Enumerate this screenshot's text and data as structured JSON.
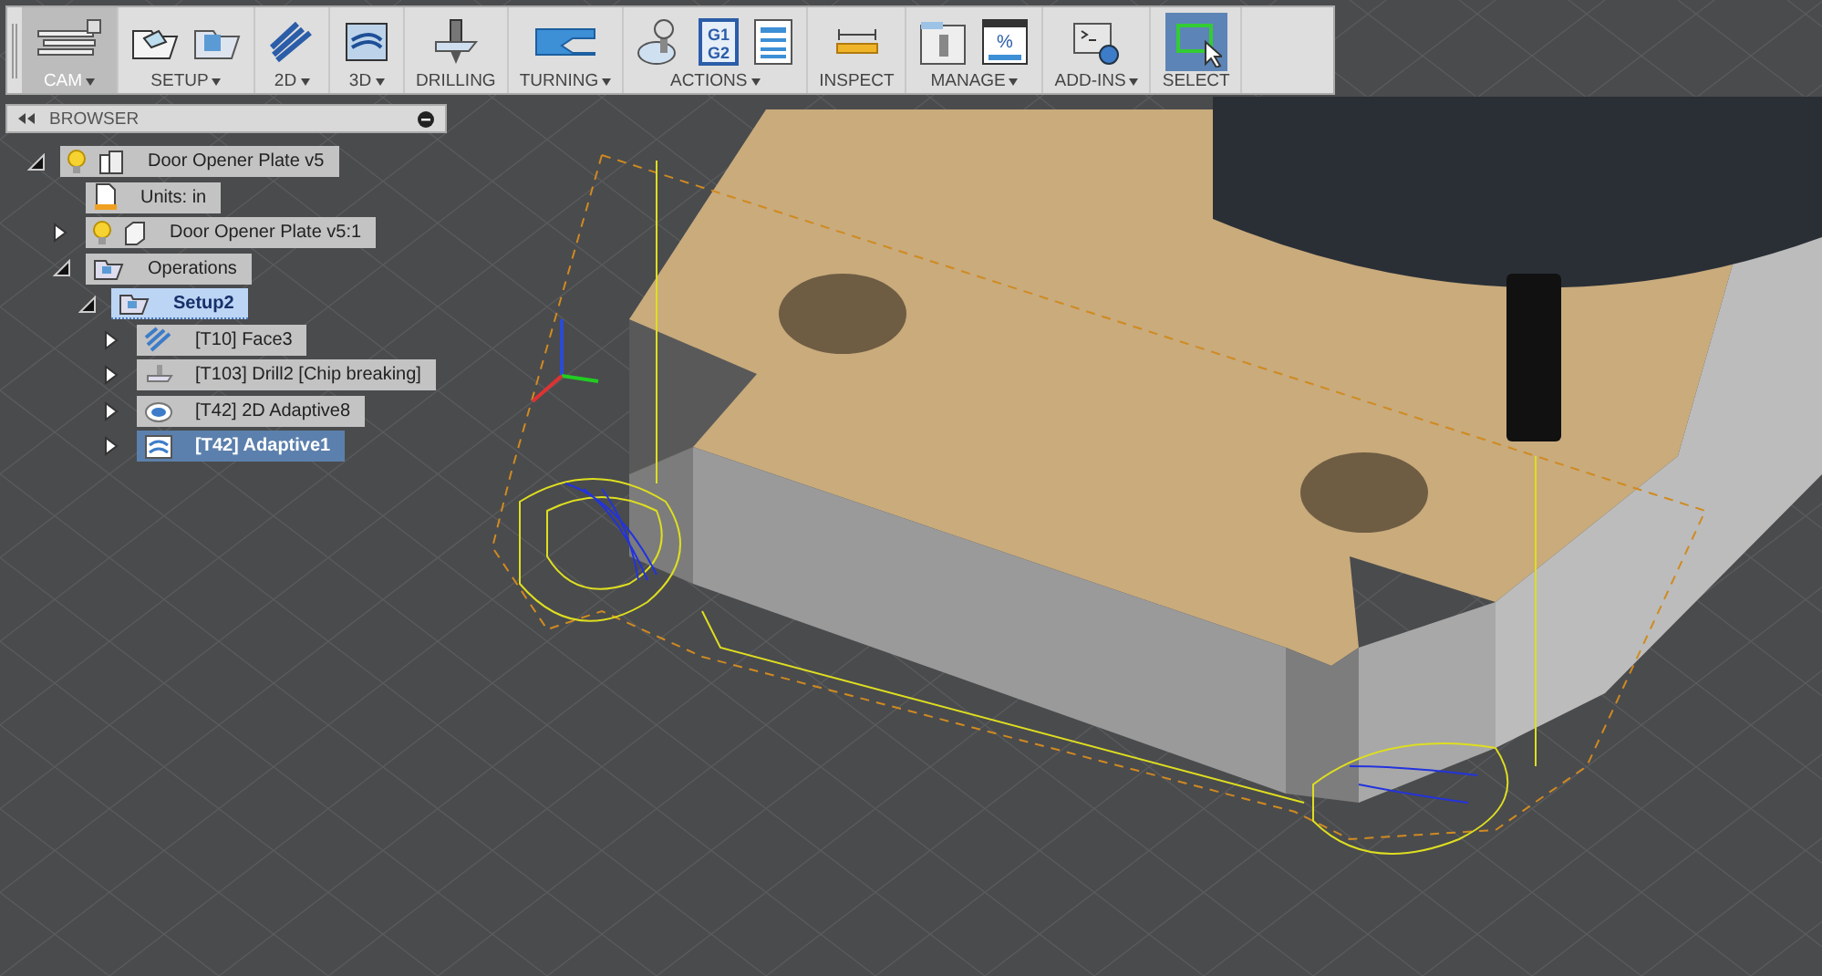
{
  "toolbar": {
    "groups": [
      {
        "label": "CAM",
        "dropdown": true,
        "selected": true
      },
      {
        "label": "SETUP",
        "dropdown": true,
        "selected": false
      },
      {
        "label": "2D",
        "dropdown": true,
        "selected": false
      },
      {
        "label": "3D",
        "dropdown": true,
        "selected": false
      },
      {
        "label": "DRILLING",
        "dropdown": false,
        "selected": false
      },
      {
        "label": "TURNING",
        "dropdown": true,
        "selected": false
      },
      {
        "label": "ACTIONS",
        "dropdown": true,
        "selected": false,
        "icon_text": [
          "G1",
          "G2"
        ]
      },
      {
        "label": "INSPECT",
        "dropdown": false,
        "selected": false
      },
      {
        "label": "MANAGE",
        "dropdown": true,
        "selected": false,
        "icon_text": [
          "%"
        ]
      },
      {
        "label": "ADD-INS",
        "dropdown": true,
        "selected": false
      },
      {
        "label": "SELECT",
        "dropdown": false,
        "selected": true
      }
    ]
  },
  "browser": {
    "title": "BROWSER",
    "tree": [
      {
        "label": "Door Opener Plate v5",
        "kind": "document",
        "expanded": true,
        "visible": true,
        "selected": false,
        "active": false,
        "children": [
          {
            "label": "Units: in",
            "kind": "units",
            "selected": false,
            "active": false
          },
          {
            "label": "Door Opener Plate v5:1",
            "kind": "component",
            "expanded": false,
            "visible": true,
            "selected": false,
            "active": false
          },
          {
            "label": "Operations",
            "kind": "setup",
            "expanded": true,
            "selected": false,
            "active": false,
            "children": [
              {
                "label": "Setup2",
                "kind": "setup",
                "expanded": true,
                "selected": false,
                "active": true,
                "children": [
                  {
                    "label": "[T10] Face3",
                    "kind": "face",
                    "expanded": false,
                    "selected": false,
                    "active": false
                  },
                  {
                    "label": "[T103] Drill2 [Chip breaking]",
                    "kind": "drill",
                    "expanded": false,
                    "selected": false,
                    "active": false
                  },
                  {
                    "label": "[T42] 2D Adaptive8",
                    "kind": "adaptive2d",
                    "expanded": false,
                    "selected": false,
                    "active": false
                  },
                  {
                    "label": "[T42] Adaptive1",
                    "kind": "adaptive3d",
                    "expanded": false,
                    "selected": true,
                    "active": false
                  }
                ]
              }
            ]
          }
        ]
      }
    ]
  }
}
